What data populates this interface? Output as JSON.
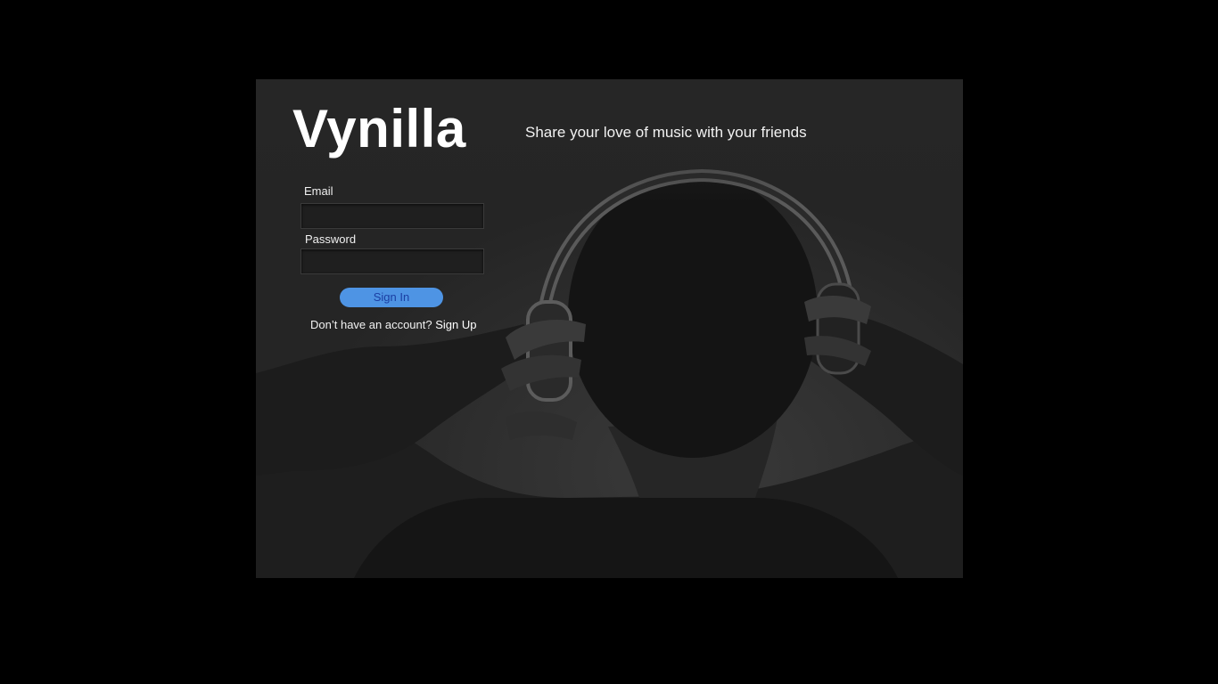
{
  "brand": {
    "name": "Vynilla",
    "tagline": "Share your love of music with your friends"
  },
  "login_form": {
    "email_label": "Email",
    "email_value": "",
    "password_label": "Password",
    "password_value": "",
    "signin_label": "Sign In",
    "signup_prompt": "Don’t have an account?",
    "signup_link": "Sign Up"
  },
  "colors": {
    "page_background": "#000000",
    "panel_background": "#252525",
    "button_background": "#4e94e4",
    "button_text": "#1b3fa3",
    "text": "#ffffff"
  },
  "background_image": {
    "subject": "person-wearing-headphones-from-behind"
  }
}
